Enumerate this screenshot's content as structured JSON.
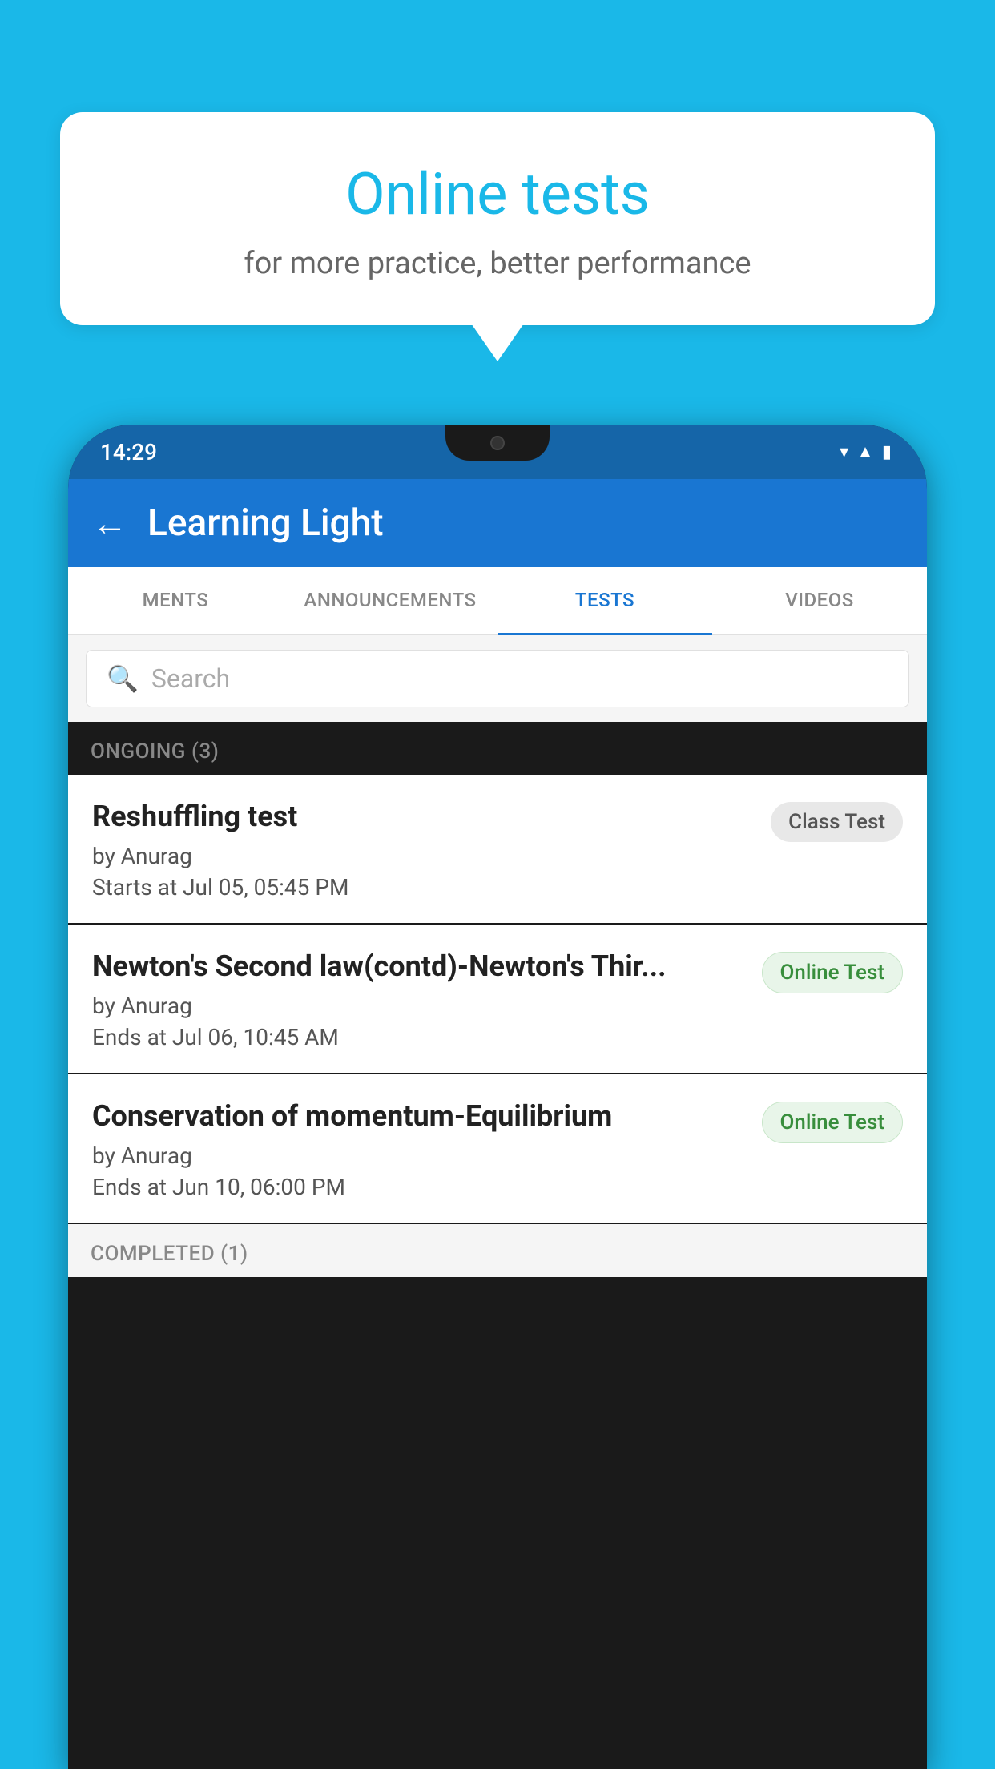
{
  "background_color": "#1ab8e8",
  "bubble": {
    "title": "Online tests",
    "subtitle": "for more practice, better performance"
  },
  "phone": {
    "status_bar": {
      "time": "14:29",
      "icons": [
        "wifi",
        "signal",
        "battery"
      ]
    },
    "app_bar": {
      "back_icon": "←",
      "title": "Learning Light"
    },
    "tabs": [
      {
        "label": "MENTS",
        "active": false
      },
      {
        "label": "ANNOUNCEMENTS",
        "active": false
      },
      {
        "label": "TESTS",
        "active": true
      },
      {
        "label": "VIDEOS",
        "active": false
      }
    ],
    "search": {
      "placeholder": "Search",
      "icon": "🔍"
    },
    "ongoing_section": {
      "header": "ONGOING (3)",
      "tests": [
        {
          "title": "Reshuffling test",
          "author": "by Anurag",
          "time_label": "Starts at",
          "time": "Jul 05, 05:45 PM",
          "badge": "Class Test",
          "badge_type": "class"
        },
        {
          "title": "Newton's Second law(contd)-Newton's Thir...",
          "author": "by Anurag",
          "time_label": "Ends at",
          "time": "Jul 06, 10:45 AM",
          "badge": "Online Test",
          "badge_type": "online"
        },
        {
          "title": "Conservation of momentum-Equilibrium",
          "author": "by Anurag",
          "time_label": "Ends at",
          "time": "Jun 10, 06:00 PM",
          "badge": "Online Test",
          "badge_type": "online"
        }
      ]
    },
    "completed_section": {
      "header": "COMPLETED (1)"
    }
  }
}
